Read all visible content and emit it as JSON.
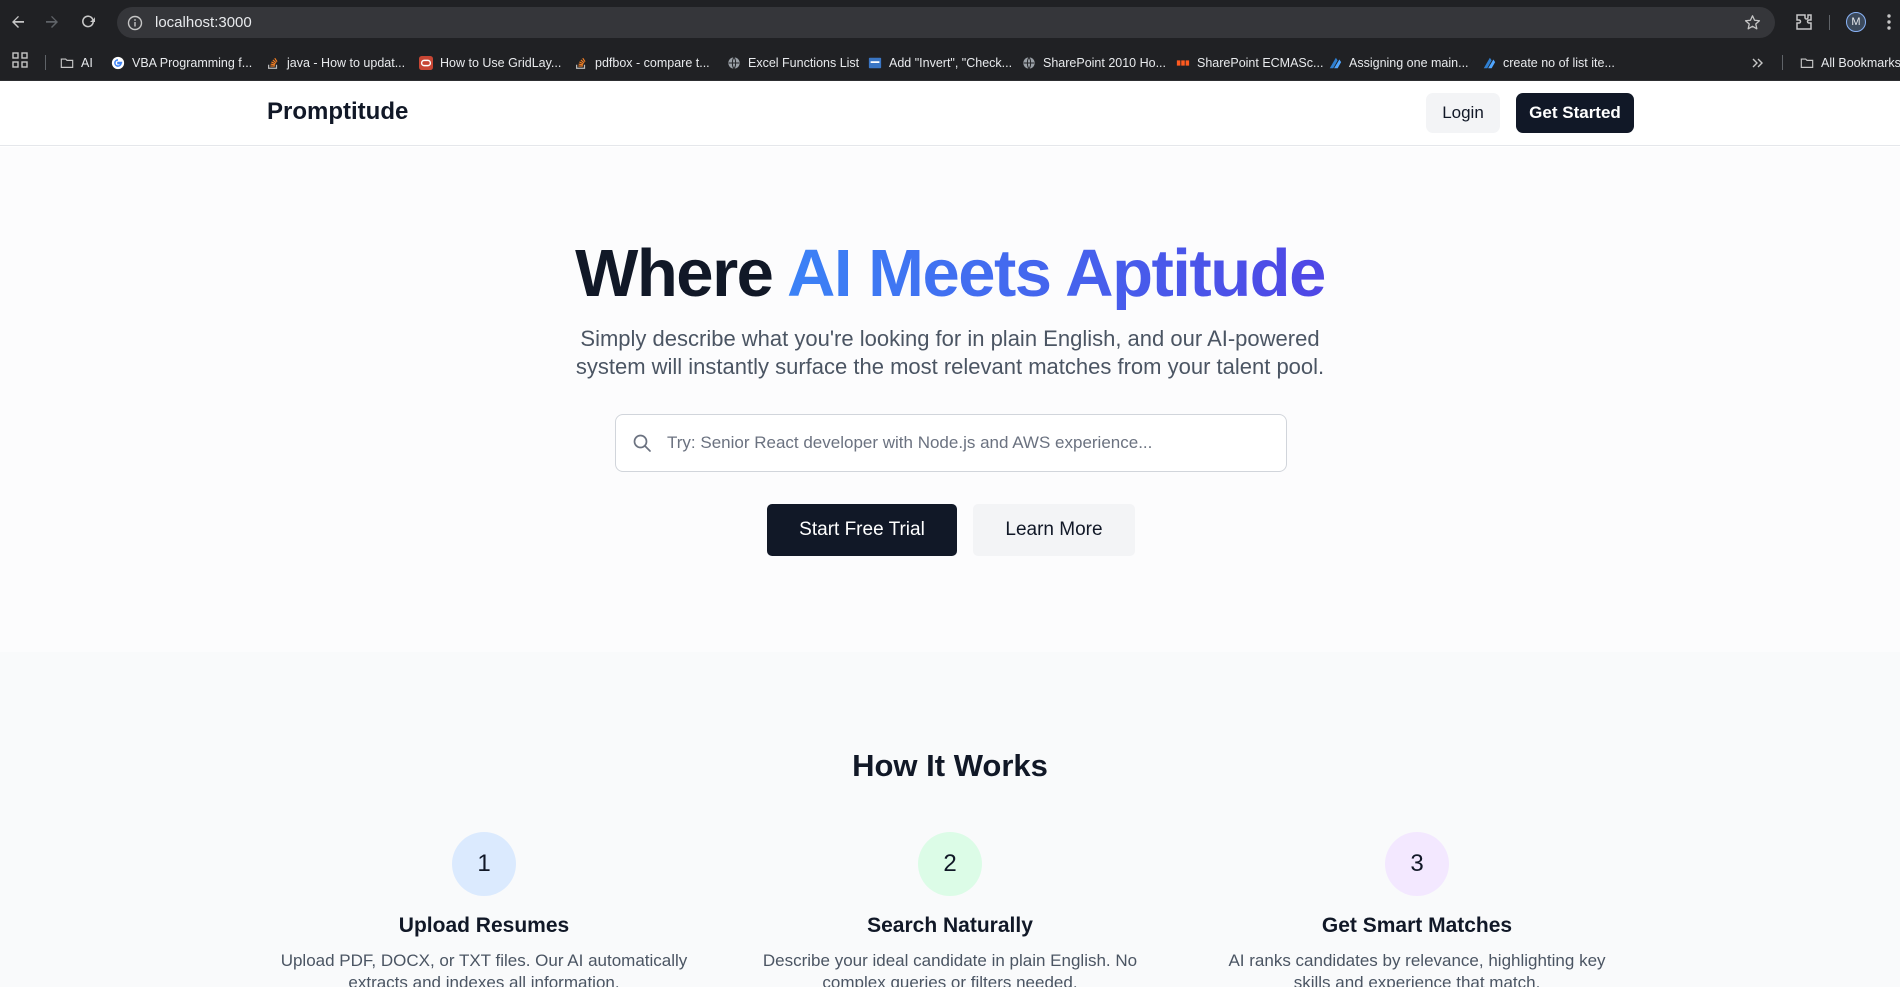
{
  "browser": {
    "url": "localhost:3000",
    "avatar_initial": "M",
    "bookmarks": [
      {
        "label": "AI",
        "icon": "folder-icon"
      },
      {
        "label": "VBA Programming f...",
        "icon": "google-icon"
      },
      {
        "label": "java - How to updat...",
        "icon": "stackoverflow-icon"
      },
      {
        "label": "How to Use GridLay...",
        "icon": "oracle-icon"
      },
      {
        "label": "pdfbox - compare t...",
        "icon": "stackoverflow-icon"
      },
      {
        "label": "Excel Functions List",
        "icon": "globe-icon"
      },
      {
        "label": "Add \"Invert\", \"Check...",
        "icon": "site-icon"
      },
      {
        "label": "SharePoint 2010 Ho...",
        "icon": "globe-icon"
      },
      {
        "label": "SharePoint ECMASc...",
        "icon": "sharepoint-icon"
      },
      {
        "label": "Assigning one main...",
        "icon": "microsoft-icon"
      },
      {
        "label": "create no of list ite...",
        "icon": "microsoft-icon"
      }
    ],
    "all_bookmarks_label": "All Bookmarks"
  },
  "header": {
    "brand": "Promptitude",
    "login_label": "Login",
    "get_started_label": "Get Started"
  },
  "hero": {
    "title_plain": "Where ",
    "title_accent": "AI Meets Aptitude",
    "subtitle": "Simply describe what you're looking for in plain English, and our AI-powered system will instantly surface the most relevant matches from your talent pool.",
    "search_placeholder": "Try: Senior React developer with Node.js and AWS experience...",
    "start_trial_label": "Start Free Trial",
    "learn_more_label": "Learn More"
  },
  "how_it_works": {
    "title": "How It Works",
    "steps": [
      {
        "number": "1",
        "title": "Upload Resumes",
        "description": "Upload PDF, DOCX, or TXT files. Our AI automatically extracts and indexes all information.",
        "color": "#dbeafe"
      },
      {
        "number": "2",
        "title": "Search Naturally",
        "description": "Describe your ideal candidate in plain English. No complex queries or filters needed.",
        "color": "#dcfce7"
      },
      {
        "number": "3",
        "title": "Get Smart Matches",
        "description": "AI ranks candidates by relevance, highlighting key skills and experience that match.",
        "color": "#f3e8ff"
      }
    ]
  },
  "colors": {
    "primary": "#111827",
    "accent_start": "#3b82f6",
    "accent_end": "#4f46e5"
  }
}
